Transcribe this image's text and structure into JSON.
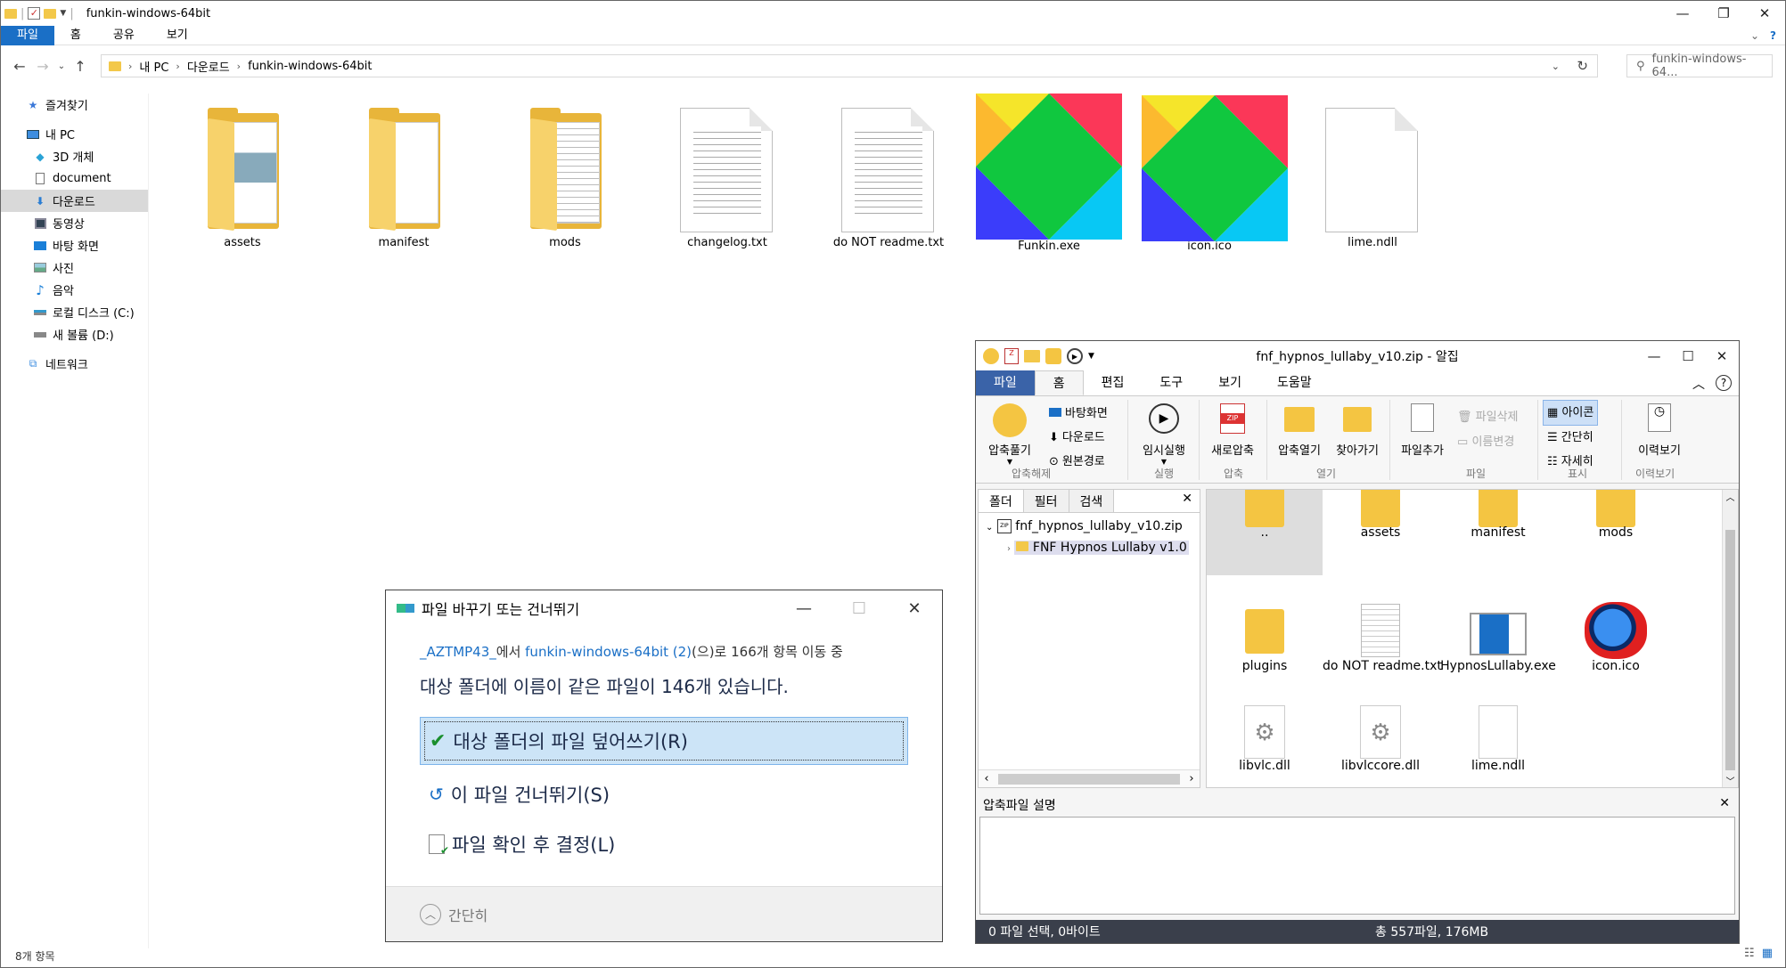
{
  "explorer": {
    "title": "funkin-windows-64bit",
    "tabs": [
      "파일",
      "홈",
      "공유",
      "보기"
    ],
    "breadcrumb": [
      "내 PC",
      "다운로드",
      "funkin-windows-64bit"
    ],
    "search_placeholder": "funkin-windows-64...",
    "status": "8개 항목",
    "nav": [
      {
        "label": "즐겨찾기",
        "icon": "star-icon"
      },
      {
        "label": "내 PC",
        "icon": "computer-icon"
      },
      {
        "label": "3D 개체",
        "icon": "cube-icon"
      },
      {
        "label": "document",
        "icon": "document-icon"
      },
      {
        "label": "다운로드",
        "icon": "download-icon"
      },
      {
        "label": "동영상",
        "icon": "video-icon"
      },
      {
        "label": "바탕 화면",
        "icon": "desktop-icon"
      },
      {
        "label": "사진",
        "icon": "picture-icon"
      },
      {
        "label": "음악",
        "icon": "music-icon"
      },
      {
        "label": "로컬 디스크 (C:)",
        "icon": "drive-icon"
      },
      {
        "label": "새 볼륨 (D:)",
        "icon": "drive-icon"
      },
      {
        "label": "네트워크",
        "icon": "network-icon"
      }
    ],
    "files": [
      {
        "name": "assets",
        "kind": "folder-icon"
      },
      {
        "name": "manifest",
        "kind": "folder-icon"
      },
      {
        "name": "mods",
        "kind": "folder-icon"
      },
      {
        "name": "changelog.txt",
        "kind": "text-file-icon"
      },
      {
        "name": "do NOT readme.txt",
        "kind": "text-file-icon"
      },
      {
        "name": "Funkin.exe",
        "kind": "haxe-logo-icon"
      },
      {
        "name": "icon.ico",
        "kind": "haxe-logo-icon"
      },
      {
        "name": "lime.ndll",
        "kind": "blank-file-icon"
      }
    ]
  },
  "alzip": {
    "title": "fnf_hypnos_lullaby_v10.zip - 알집",
    "tabs": [
      "파일",
      "홈",
      "편집",
      "도구",
      "보기",
      "도움말"
    ],
    "ribbon": {
      "extract": "압축풀기",
      "desktop": "바탕화면",
      "download": "다운로드",
      "original": "원본경로",
      "group_extract": "압축해제",
      "temp_run": "임시실행",
      "group_run": "실행",
      "new_zip": "새로압축",
      "group_zip": "압축",
      "open_zip": "압축열기",
      "find": "찾아가기",
      "group_open": "열기",
      "add_file": "파일추가",
      "delete_file": "파일삭제",
      "rename": "이름변경",
      "group_file": "파일",
      "icons": "아이콘",
      "simple": "간단히",
      "detail": "자세히",
      "group_view": "표시",
      "history": "이력보기",
      "group_history": "이력보기"
    },
    "pane_tabs": [
      "폴더",
      "필터",
      "검색"
    ],
    "tree_root": "fnf_hypnos_lullaby_v10.zip",
    "tree_child": "FNF Hypnos Lullaby v1.0",
    "items": [
      {
        "name": "..",
        "kind": "folder-icon"
      },
      {
        "name": "assets",
        "kind": "folder-icon"
      },
      {
        "name": "manifest",
        "kind": "folder-icon"
      },
      {
        "name": "mods",
        "kind": "folder-icon"
      },
      {
        "name": "plugins",
        "kind": "folder-icon"
      },
      {
        "name": "do NOT readme.txt",
        "kind": "text-file-icon"
      },
      {
        "name": "HypnosLullaby.exe",
        "kind": "app-window-icon"
      },
      {
        "name": "icon.ico",
        "kind": "character-icon"
      },
      {
        "name": "libvlc.dll",
        "kind": "gear-file-icon"
      },
      {
        "name": "libvlccore.dll",
        "kind": "gear-file-icon"
      },
      {
        "name": "lime.ndll",
        "kind": "blank-file-icon"
      }
    ],
    "desc_title": "압축파일 설명",
    "status_left": "0 파일 선택,  0바이트",
    "status_right": "총 557파일,  176MB"
  },
  "dialog": {
    "title": "파일 바꾸기 또는 건너뛰기",
    "src": "_AZTMP43_",
    "src_mid": "에서 ",
    "dest": "funkin-windows-64bit (2)",
    "count_text": "(으)로 166개 항목 이동 중",
    "headline": "대상 폴더에 이름이 같은 파일이 146개 있습니다.",
    "options": [
      "대상 폴더의 파일 덮어쓰기(R)",
      "이 파일 건너뛰기(S)",
      "파일 확인 후 결정(L)"
    ],
    "collapse": "간단히"
  }
}
